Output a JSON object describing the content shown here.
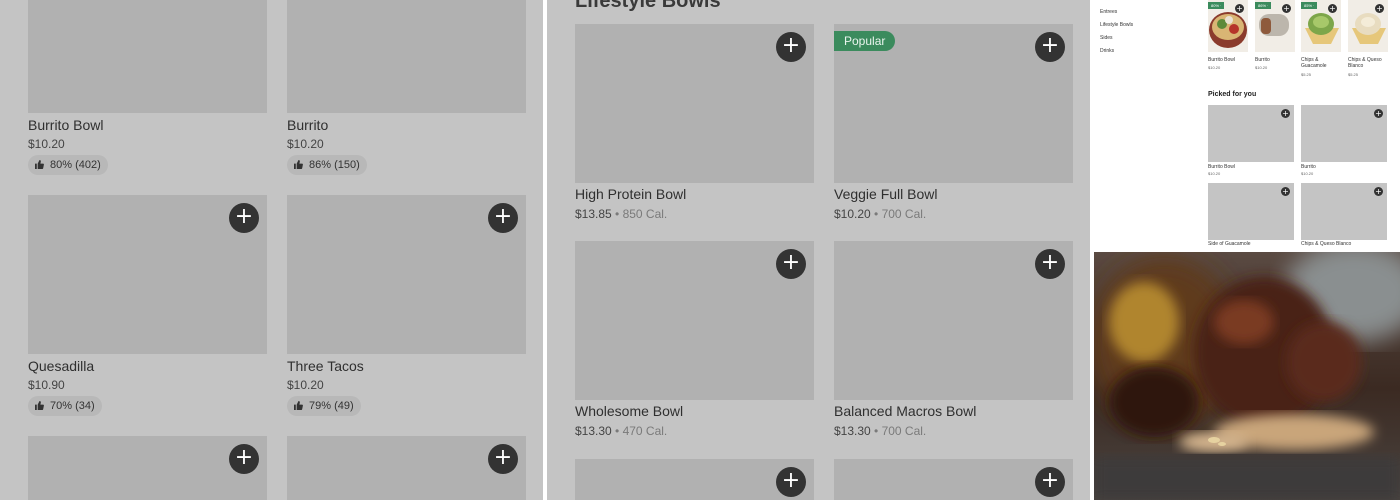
{
  "panel_a": {
    "items": [
      {
        "name": "Burrito Bowl",
        "price": "$10.20",
        "rating": "80% (402)"
      },
      {
        "name": "Burrito",
        "price": "$10.20",
        "rating": "86% (150)"
      },
      {
        "name": "Quesadilla",
        "price": "$10.90",
        "rating": "70% (34)"
      },
      {
        "name": "Three Tacos",
        "price": "$10.20",
        "rating": "79% (49)"
      }
    ],
    "add_symbol": "+"
  },
  "panel_b": {
    "section_title": "Lifestyle Bowls",
    "popular_badge": "Popular",
    "items": [
      {
        "name": "High Protein Bowl",
        "price": "$13.85",
        "calories": " • 850 Cal."
      },
      {
        "name": "Veggie Full Bowl",
        "price": "$10.20",
        "calories": " • 700 Cal."
      },
      {
        "name": "Wholesome Bowl",
        "price": "$13.30",
        "calories": " • 470 Cal."
      },
      {
        "name": "Balanced Macros Bowl",
        "price": "$13.30",
        "calories": " • 700 Cal."
      }
    ]
  },
  "panel_c": {
    "sidebar": [
      "Entrees",
      "Lifestyle Bowls",
      "Sides",
      "Drinks"
    ],
    "top_items": [
      {
        "name": "Burrito Bowl",
        "price": "$10.20",
        "badge": "80% ·"
      },
      {
        "name": "Burrito",
        "price": "$10.20",
        "badge": "86% ·"
      },
      {
        "name": "Chips & Guacamole",
        "price": "$5.25",
        "badge": "85% ·"
      },
      {
        "name": "Chips & Queso Blanco",
        "price": "$5.25",
        "badge": ""
      }
    ],
    "picked_heading": "Picked for you",
    "picked_items": [
      {
        "name": "Burrito Bowl",
        "price": "$10.20"
      },
      {
        "name": "Burrito",
        "price": "$10.20"
      },
      {
        "name": "Side of Guacamole",
        "price": ""
      },
      {
        "name": "Chips & Queso Blanco",
        "price": ""
      }
    ]
  },
  "colors": {
    "accent_green": "#3b8b5d",
    "button_dark": "#333333",
    "placeholder_gray": "#b1b1b1"
  },
  "icons": [
    "add-icon",
    "thumbs-up-icon"
  ]
}
